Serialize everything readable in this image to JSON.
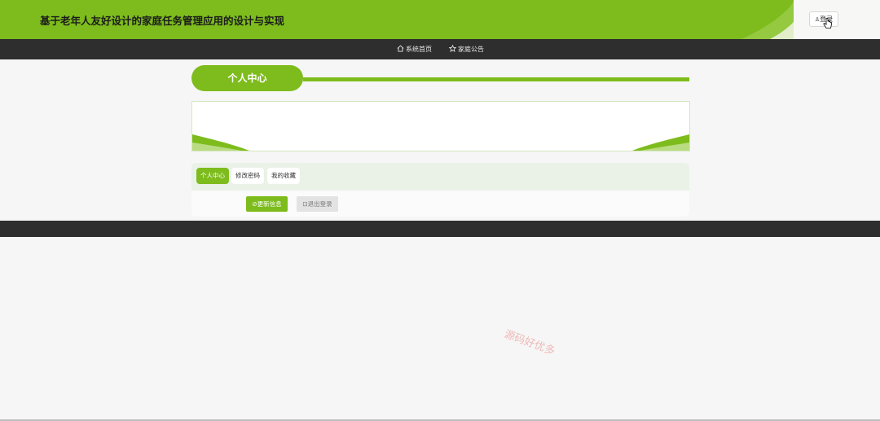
{
  "header": {
    "title": "基于老年人友好设计的家庭任务管理应用的设计与实现",
    "login_label": "登录"
  },
  "nav": {
    "items": [
      {
        "label": "系统首页",
        "icon": "home-icon"
      },
      {
        "label": "家庭公告",
        "icon": "star-icon"
      }
    ]
  },
  "section": {
    "title": "个人中心"
  },
  "tabs": [
    {
      "label": "个人中心",
      "active": true
    },
    {
      "label": "修改密码",
      "active": false
    },
    {
      "label": "我的收藏",
      "active": false
    }
  ],
  "actions": {
    "update_label": "更新信息",
    "logout_label": "退出登录"
  },
  "watermark": {
    "text": "源码好优多"
  },
  "colors": {
    "accent": "#7dbc1c",
    "nav_bg": "#2e2e2e",
    "page_bg": "#f5f6f5"
  }
}
